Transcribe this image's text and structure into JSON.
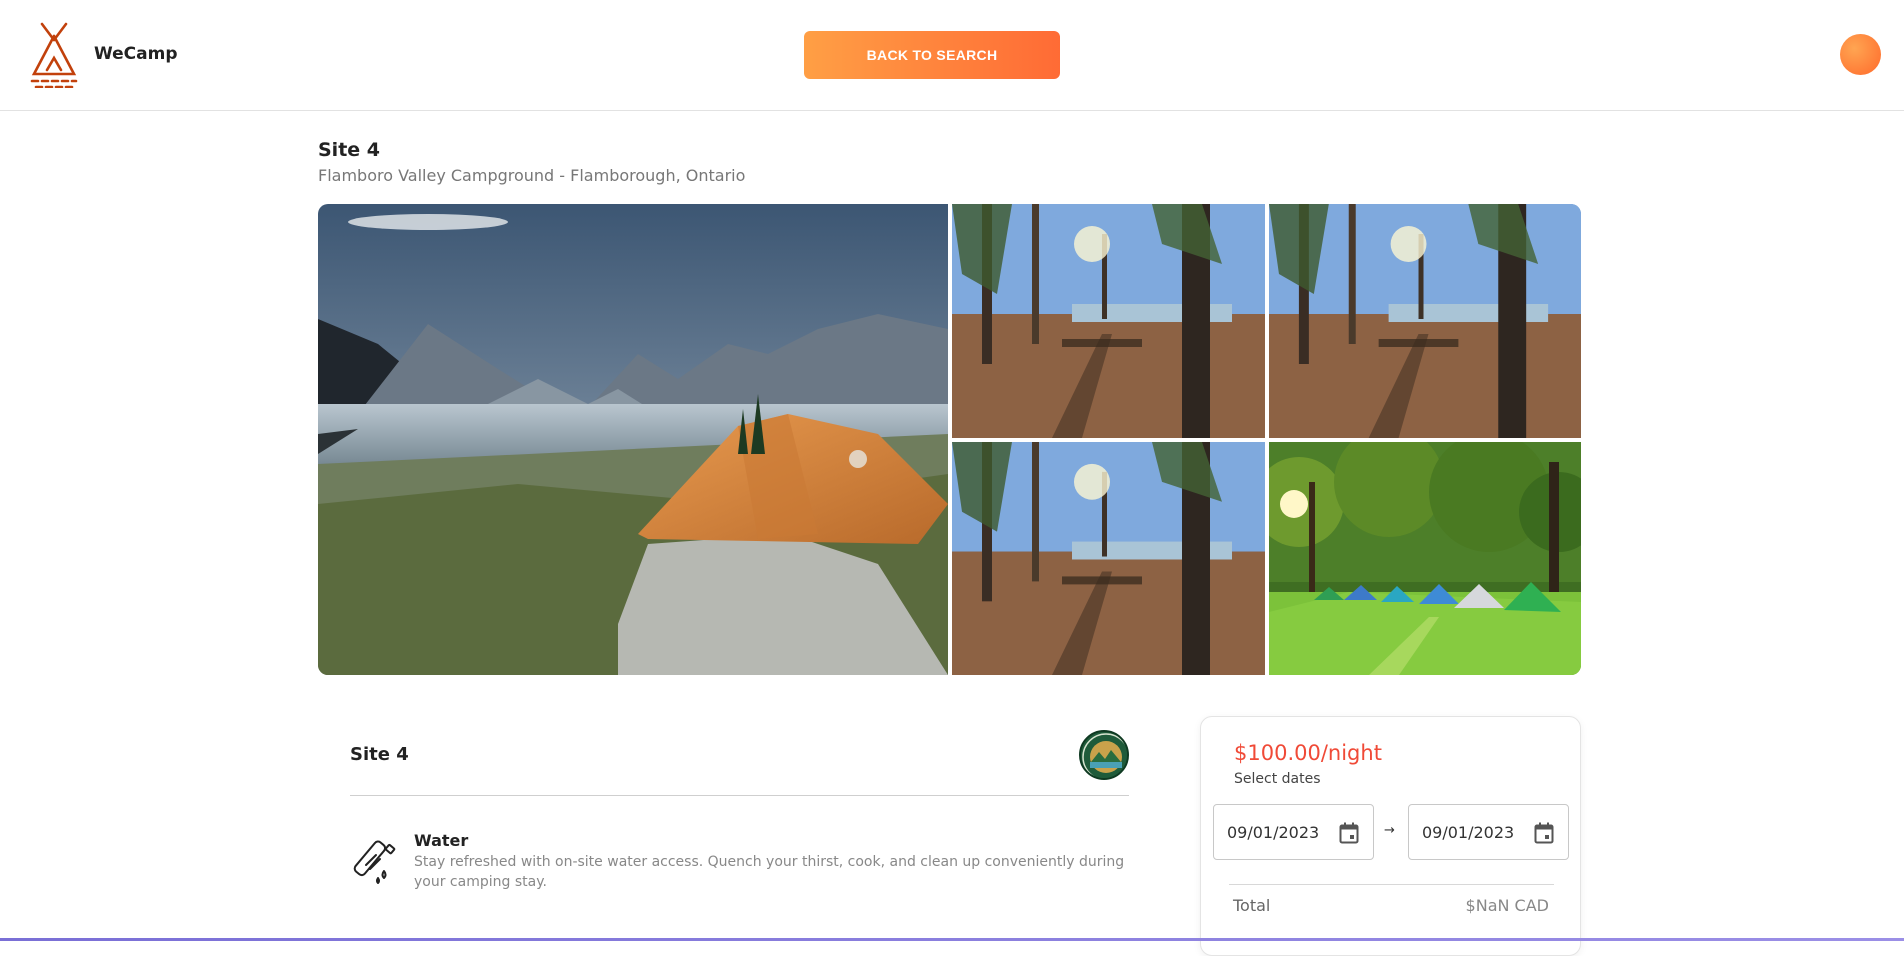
{
  "header": {
    "brand": "WeCamp",
    "back_label": "BACK TO SEARCH"
  },
  "site": {
    "title": "Site 4",
    "location": "Flamboro Valley Campground - Flamborough, Ontario"
  },
  "details": {
    "title": "Site 4",
    "amenity": {
      "name": "Water",
      "icon": "water-bottle-icon",
      "description": "Stay refreshed with on-site water access. Quench your thirst, cook, and clean up conveniently during your camping stay."
    }
  },
  "booking": {
    "price": "$100.00/night",
    "select_dates": "Select dates",
    "start_date": "09/01/2023",
    "end_date": "09/01/2023",
    "arrow": "→",
    "total_label": "Total",
    "total_value": "$NaN CAD"
  },
  "colors": {
    "accent": "#ff7a3d",
    "price": "#f04a37"
  }
}
